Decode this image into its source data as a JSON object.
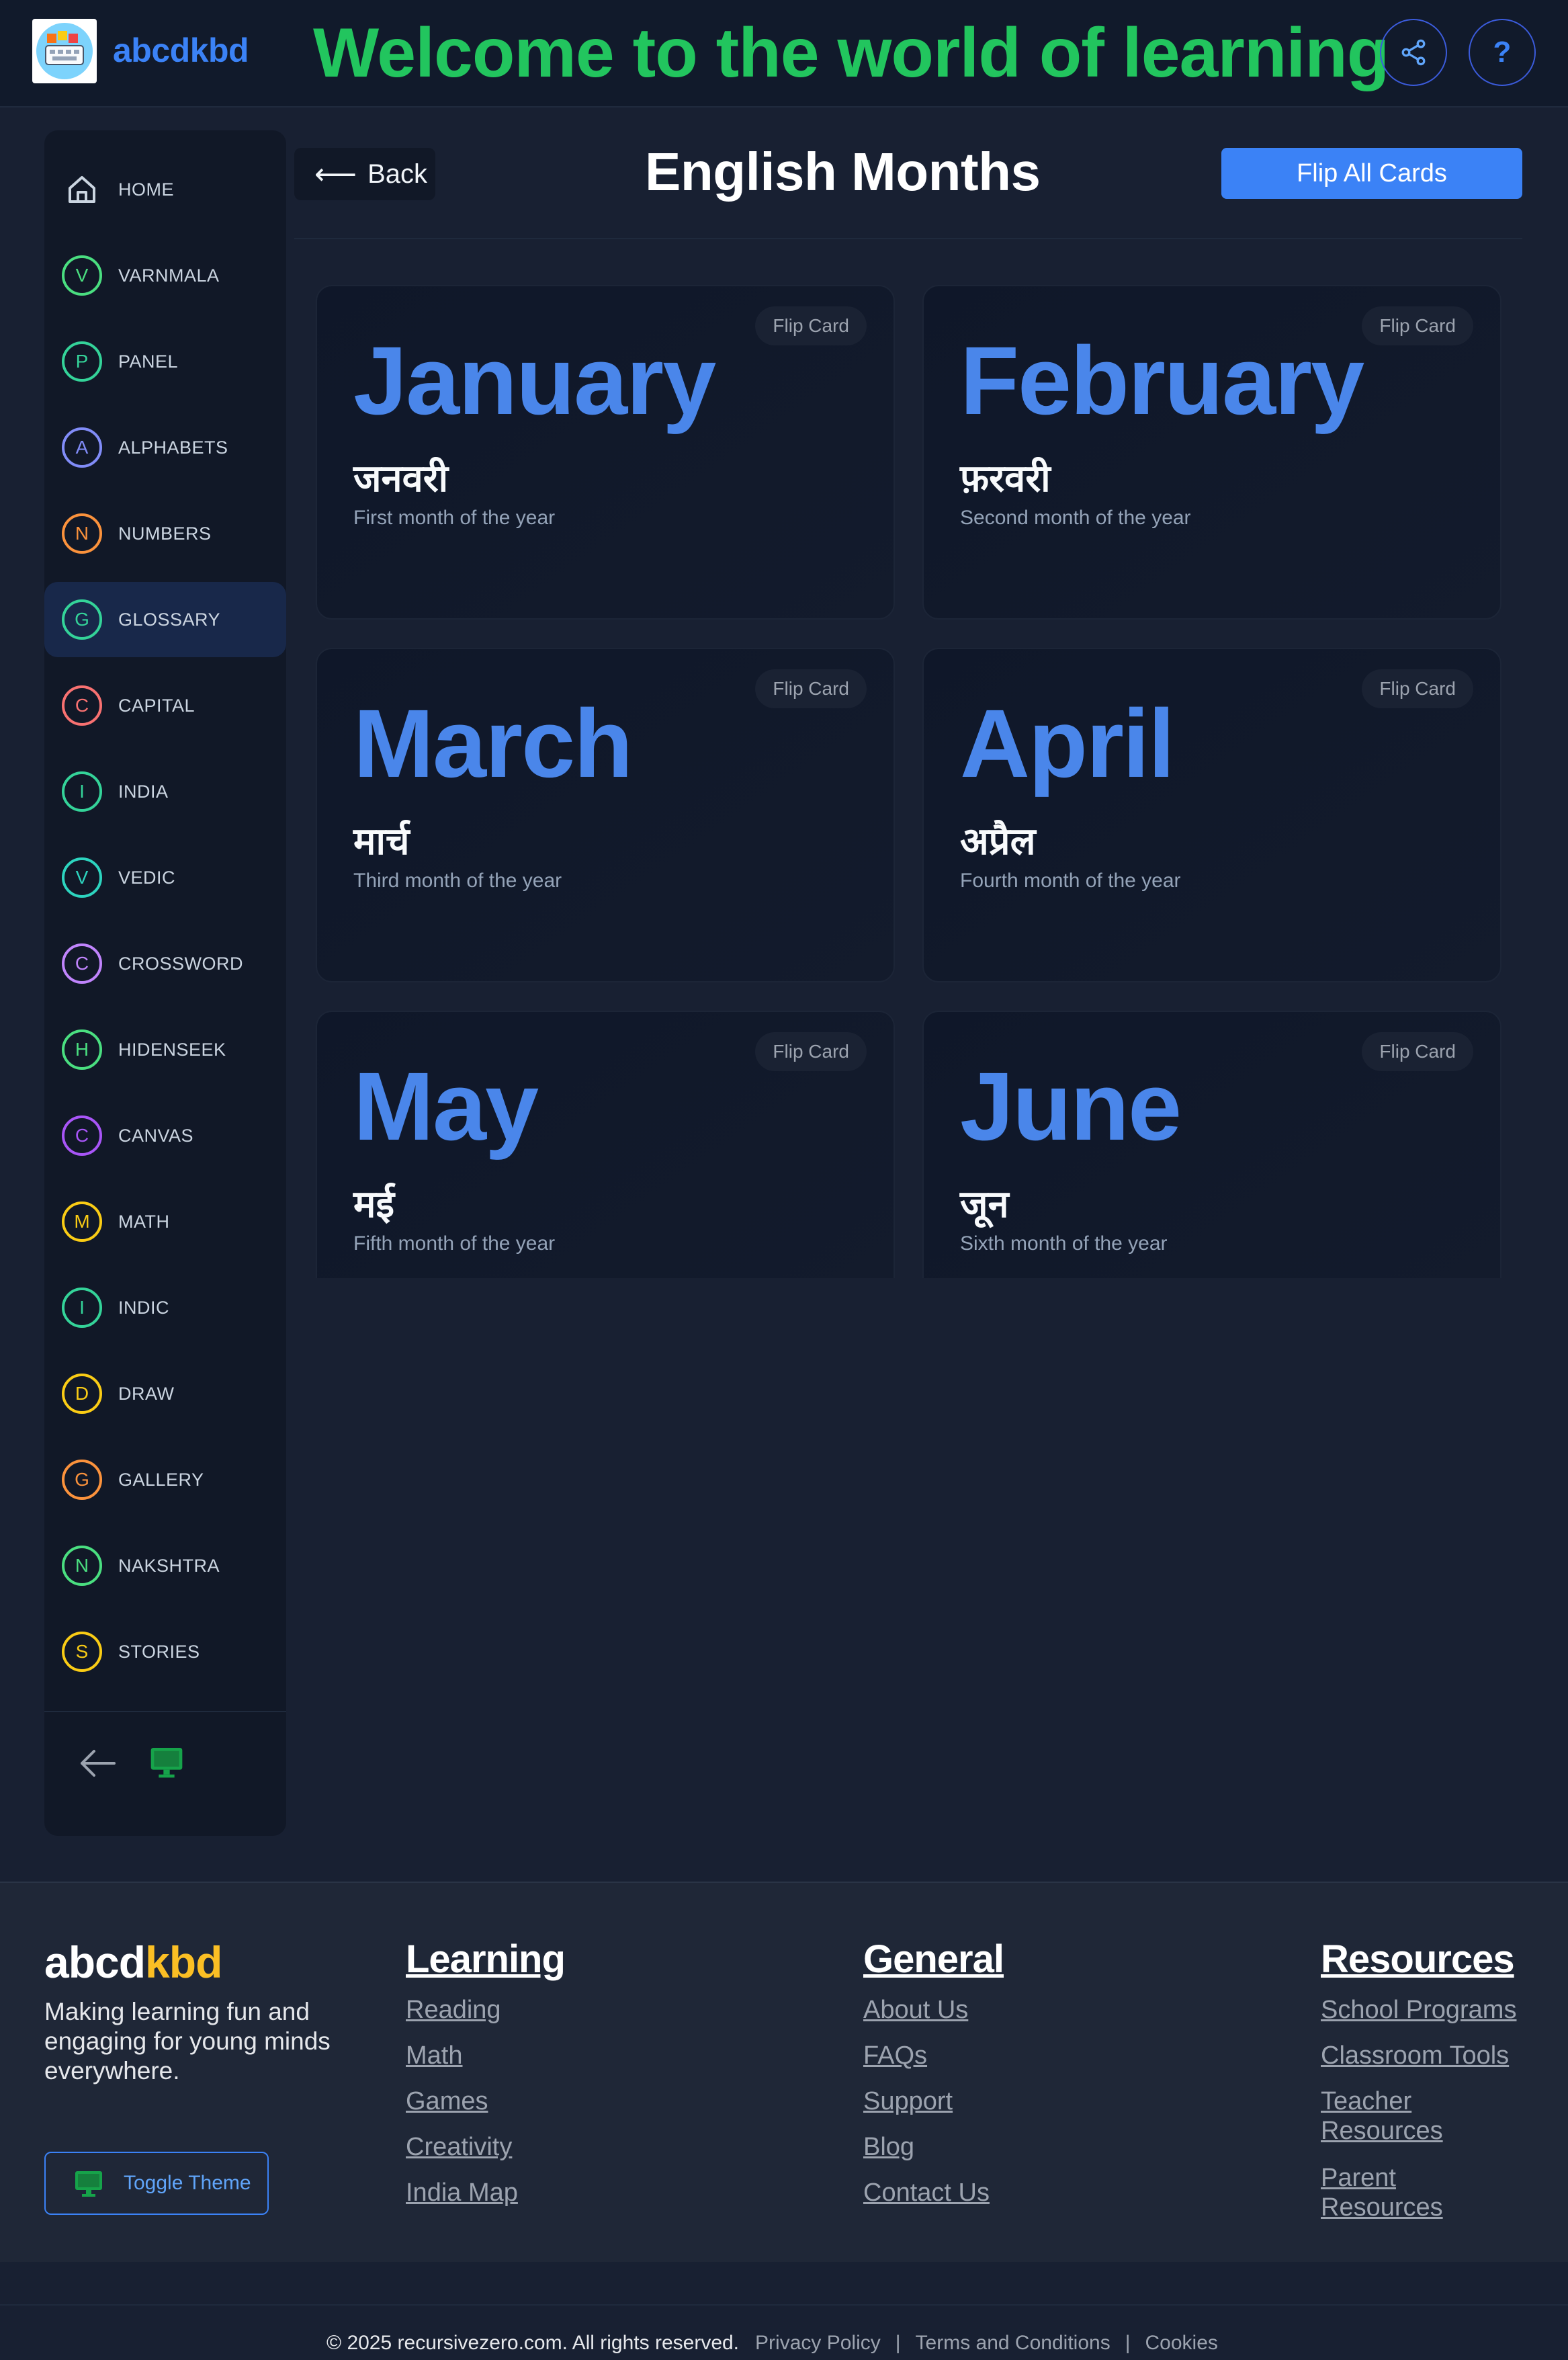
{
  "header": {
    "brand": "abcdkbd",
    "welcome": "Welcome to the world of learning",
    "help_label": "?"
  },
  "sidebar": {
    "items": [
      {
        "label": "HOME",
        "letter": "",
        "color": "#94a3b8"
      },
      {
        "label": "VARNMALA",
        "letter": "V",
        "color": "#4ade80"
      },
      {
        "label": "PANEL",
        "letter": "P",
        "color": "#34d399"
      },
      {
        "label": "ALPHABETS",
        "letter": "A",
        "color": "#818cf8"
      },
      {
        "label": "NUMBERS",
        "letter": "N",
        "color": "#fb923c"
      },
      {
        "label": "GLOSSARY",
        "letter": "G",
        "color": "#34d399"
      },
      {
        "label": "CAPITAL",
        "letter": "C",
        "color": "#f87171"
      },
      {
        "label": "INDIA",
        "letter": "I",
        "color": "#34d399"
      },
      {
        "label": "VEDIC",
        "letter": "V",
        "color": "#2dd4bf"
      },
      {
        "label": "CROSSWORD",
        "letter": "C",
        "color": "#c084fc"
      },
      {
        "label": "HIDENSEEK",
        "letter": "H",
        "color": "#4ade80"
      },
      {
        "label": "CANVAS",
        "letter": "C",
        "color": "#a855f7"
      },
      {
        "label": "MATH",
        "letter": "M",
        "color": "#facc15"
      },
      {
        "label": "INDIC",
        "letter": "I",
        "color": "#34d399"
      },
      {
        "label": "DRAW",
        "letter": "D",
        "color": "#facc15"
      },
      {
        "label": "GALLERY",
        "letter": "G",
        "color": "#fb923c"
      },
      {
        "label": "NAKSHTRA",
        "letter": "N",
        "color": "#4ade80"
      },
      {
        "label": "STORIES",
        "letter": "S",
        "color": "#facc15"
      }
    ],
    "active": "GLOSSARY"
  },
  "main": {
    "back_label": "Back",
    "title": "English Months",
    "flip_all_label": "Flip All Cards",
    "cards": [
      {
        "month": "January",
        "hindi": "जनवरी",
        "desc": "First month of the year",
        "badge": "Flip Card"
      },
      {
        "month": "February",
        "hindi": "फ़रवरी",
        "desc": "Second month of the year",
        "badge": "Flip Card"
      },
      {
        "month": "March",
        "hindi": "मार्च",
        "desc": "Third month of the year",
        "badge": "Flip Card"
      },
      {
        "month": "April",
        "hindi": "अप्रैल",
        "desc": "Fourth month of the year",
        "badge": "Flip Card"
      },
      {
        "month": "May",
        "hindi": "मई",
        "desc": "Fifth month of the year",
        "badge": "Flip Card"
      },
      {
        "month": "June",
        "hindi": "जून",
        "desc": "Sixth month of the year",
        "badge": "Flip Card"
      }
    ]
  },
  "footer": {
    "brand_a": "abcd",
    "brand_b": "kbd",
    "tagline": "Making learning fun and engaging for young minds everywhere.",
    "toggle_theme": "Toggle Theme",
    "learning": {
      "title": "Learning",
      "links": [
        "Reading",
        "Math",
        "Games",
        "Creativity",
        "India Map"
      ]
    },
    "general": {
      "title": "General",
      "links": [
        "About Us",
        "FAQs",
        "Support",
        "Blog",
        "Contact Us"
      ]
    },
    "resources": {
      "title": "Resources",
      "links": [
        "School Programs",
        "Classroom Tools",
        "Teacher Resources",
        "Parent Resources"
      ]
    },
    "copyright": "© 2025 recursivezero.com. All rights reserved.",
    "privacy": "Privacy Policy",
    "terms": "Terms and Conditions",
    "cookies": "Cookies",
    "separator": "|"
  },
  "colors": {
    "accent_blue": "#3b82f6",
    "welcome_green": "#22c55e",
    "brand_yellow": "#fbbf24",
    "month_blue": "#4a86ea"
  }
}
